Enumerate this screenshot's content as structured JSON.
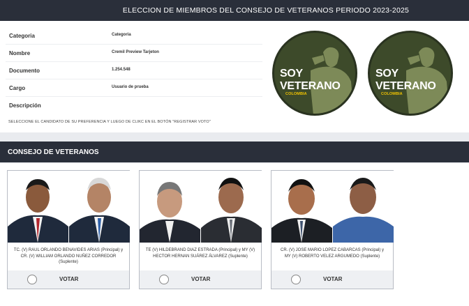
{
  "header": {
    "title": "ELECCION DE MIEMBROS DEL CONSEJO DE VETERANOS PERIODO 2023-2025"
  },
  "info": {
    "rows": [
      {
        "label": "Categoria",
        "value": "Categoria"
      },
      {
        "label": "Nombre",
        "value": "Cremil Preview Tarjeton"
      },
      {
        "label": "Documento",
        "value": "1.254.548"
      },
      {
        "label": "Cargo",
        "value": "Usuario de prueba"
      },
      {
        "label": "Descripción",
        "value": ""
      }
    ],
    "instructions": "SELECCIONE EL CANDIDATO DE SU PREFERENCIA Y LUEGO DE CLIKC EN EL BOTÓN \"REGISTRAR VOTO\""
  },
  "logos": [
    {
      "line1": "SOY",
      "line2": "VETERANO",
      "brand": "COLOMBIA"
    },
    {
      "line1": "SOY",
      "line2": "VETERANO",
      "brand": "COLOMBIA"
    }
  ],
  "section": {
    "title": "CONSEJO DE VETERANOS"
  },
  "candidates": [
    {
      "name": "TC. (V) RAUL ORLANDO BENAVIDES ARIAS (Principal) y CR. (V) WILLIAM ORLANDO NUÑEZ CORREDOR (Suplente)",
      "vote_label": "VOTAR"
    },
    {
      "name": "TE (V) HILDEBRAND DIAZ ESTRADA (Principal) y MY (V) HECTOR HERNAN SUÁREZ ÁLVAREZ (Suplente)",
      "vote_label": "VOTAR"
    },
    {
      "name": "CR. (V) JOSE MARIO LOPEZ CABARCAS (Principal) y MY (V) ROBERTO VELEZ ARGUMEDO (Suplente)",
      "vote_label": "VOTAR"
    }
  ],
  "colors": {
    "header_bg": "#2a2f3a",
    "logo_green": "#3d4a2a",
    "brand_yellow": "#f2c300"
  }
}
